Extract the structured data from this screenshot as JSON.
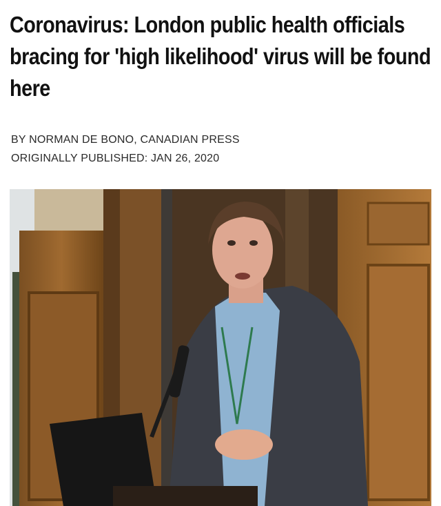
{
  "article": {
    "headline": "Coronavirus: London public health officials bracing for 'high likelihood' virus will be found here",
    "byline": "BY NORMAN DE BONO, CANADIAN PRESS",
    "published": "ORIGINALLY PUBLISHED: JAN 26, 2020"
  },
  "photo": {
    "icon": "photo-of-speaker-at-podium"
  }
}
